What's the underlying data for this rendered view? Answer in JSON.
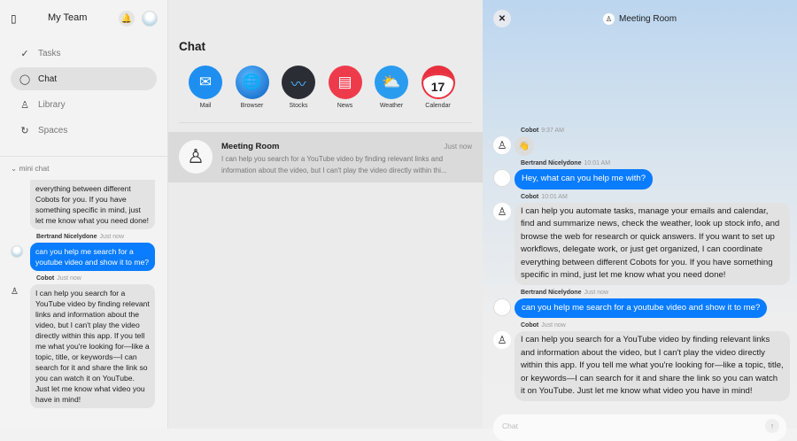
{
  "sidebar": {
    "team": "My Team",
    "nav": [
      {
        "label": "Tasks"
      },
      {
        "label": "Chat"
      },
      {
        "label": "Library"
      },
      {
        "label": "Spaces"
      }
    ],
    "mini_label": "mini chat",
    "mini": [
      {
        "text": "everything between different Cobots for you. If you have something specific in mind, just let me know what you need done!"
      },
      {
        "sender": "Bertrand Nicelydone",
        "time": "Just now",
        "text": "can you help me search for a youtube video and show it to me?"
      },
      {
        "sender": "Cobot",
        "time": "Just now",
        "text": "I can help you search for a YouTube video by finding relevant links and information about the video, but I can't play the video directly within this app. If you tell me what you're looking for—like a topic, title, or keywords—I can search for it and share the link so you can watch it on YouTube. Just let me know what video you have in mind!"
      }
    ]
  },
  "middle": {
    "title": "Chat",
    "apps": [
      {
        "label": "Mail",
        "icon": "✉",
        "color": "#1e8ff0"
      },
      {
        "label": "Browser",
        "icon": "🌐",
        "color": "#1a7ee0"
      },
      {
        "label": "Stocks",
        "icon": "〰",
        "color": "#2a2d33"
      },
      {
        "label": "News",
        "icon": "📰",
        "color": "#ee3b4c"
      },
      {
        "label": "Weather",
        "icon": "⛅",
        "color": "#2a9cf0"
      },
      {
        "label": "Calendar",
        "icon": "17",
        "color": "#e8303f"
      }
    ],
    "conversation": {
      "name": "Meeting Room",
      "time": "Just now",
      "preview": "I can help you search for a YouTube video by finding relevant links and information about the video, but I can't play the video directly within thi..."
    }
  },
  "right": {
    "title": "Meeting Room",
    "input_placeholder": "Chat",
    "messages": [
      {
        "sender": "Cobot",
        "time": "9:37 AM",
        "text": "👋"
      },
      {
        "sender": "Bertrand Nicelydone",
        "time": "10:01 AM",
        "text": "Hey, what can you help me with?"
      },
      {
        "sender": "Cobot",
        "time": "10:01 AM",
        "text": "I can help you automate tasks, manage your emails and calendar, find and summarize news, check the weather, look up stock info, and browse the web for research or quick answers. If you want to set up workflows, delegate work, or just get organized, I can coordinate everything between different Cobots for you. If you have something specific in mind, just let me know what you need done!"
      },
      {
        "sender": "Bertrand Nicelydone",
        "time": "Just now",
        "text": "can you help me search for a youtube video and show it to me?"
      },
      {
        "sender": "Cobot",
        "time": "Just now",
        "text": "I can help you search for a YouTube video by finding relevant links and information about the video, but I can't play the video directly within this app. If you tell me what you're looking for—like a topic, title, or keywords—I can search for it and share the link so you can watch it on YouTube. Just let me know what video you have in mind!"
      }
    ]
  }
}
